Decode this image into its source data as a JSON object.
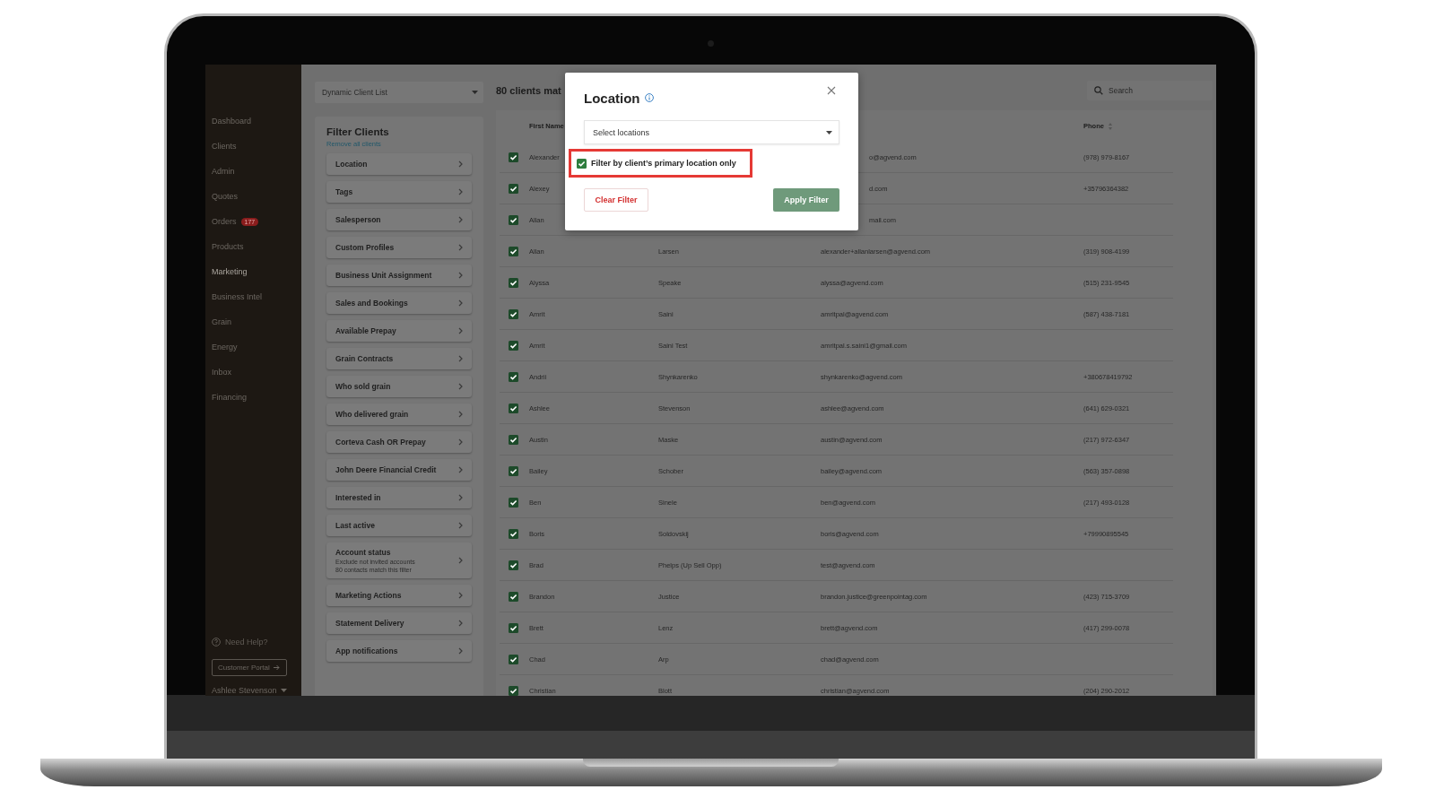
{
  "sidebar": {
    "items": [
      {
        "label": "Dashboard",
        "selected": false
      },
      {
        "label": "Clients",
        "selected": false
      },
      {
        "label": "Admin",
        "selected": false
      },
      {
        "label": "Quotes",
        "selected": false
      },
      {
        "label": "Orders",
        "selected": false,
        "badge": "177"
      },
      {
        "label": "Products",
        "selected": false
      },
      {
        "label": "Marketing",
        "selected": true
      },
      {
        "label": "Business Intel",
        "selected": false
      },
      {
        "label": "Grain",
        "selected": false
      },
      {
        "label": "Energy",
        "selected": false
      },
      {
        "label": "Inbox",
        "selected": false
      },
      {
        "label": "Financing",
        "selected": false
      }
    ],
    "help": "Need Help?",
    "portal_button": "Customer Portal",
    "user": "Ashlee Stevenson"
  },
  "list_dropdown": {
    "value": "Dynamic Client List"
  },
  "filter_panel": {
    "title": "Filter Clients",
    "remove_link": "Remove all clients",
    "filters": [
      {
        "label": "Location"
      },
      {
        "label": "Tags"
      },
      {
        "label": "Salesperson"
      },
      {
        "label": "Custom Profiles"
      },
      {
        "label": "Business Unit Assignment"
      },
      {
        "label": "Sales and Bookings"
      },
      {
        "label": "Available Prepay"
      },
      {
        "label": "Grain Contracts"
      },
      {
        "label": "Who sold grain"
      },
      {
        "label": "Who delivered grain"
      },
      {
        "label": "Corteva Cash OR Prepay"
      },
      {
        "label": "John Deere Financial Credit"
      },
      {
        "label": "Interested in"
      },
      {
        "label": "Last active"
      },
      {
        "label": "Account status",
        "details": [
          "Exclude not invited accounts",
          "80 contacts match this filter"
        ]
      },
      {
        "label": "Marketing Actions"
      },
      {
        "label": "Statement Delivery"
      },
      {
        "label": "App notifications"
      }
    ]
  },
  "results": {
    "heading": "80 clients mat",
    "search": {
      "placeholder": "Search"
    }
  },
  "table": {
    "header": {
      "first_name": "First Name",
      "phone": "Phone"
    },
    "rows": [
      {
        "checked": true,
        "first_name": "Alexander",
        "email": "o@agvend.com",
        "phone": "(978) 979-8167"
      },
      {
        "checked": true,
        "first_name": "Alexey",
        "email": "d.com",
        "phone": "+35796364382"
      },
      {
        "checked": true,
        "first_name": "Allan",
        "email": "mail.com"
      },
      {
        "checked": true,
        "first_name": "Allan",
        "last_name": "Larsen",
        "email": "alexander+allanlarsen@agvend.com",
        "phone": "(319) 908-4199"
      },
      {
        "checked": true,
        "first_name": "Alyssa",
        "last_name": "Speake",
        "email": "alyssa@agvend.com",
        "phone": "(515) 231-9545"
      },
      {
        "checked": true,
        "first_name": "Amrit",
        "last_name": "Saini",
        "email": "amritpal@agvend.com",
        "phone": "(587) 438-7181"
      },
      {
        "checked": true,
        "first_name": "Amrit",
        "last_name": "Saini Test",
        "email": "amritpal.s.saini1@gmail.com"
      },
      {
        "checked": true,
        "first_name": "Andrii",
        "last_name": "Shynkarenko",
        "email": "shynkarenko@agvend.com",
        "phone": "+380678419792"
      },
      {
        "checked": true,
        "first_name": "Ashlee",
        "last_name": "Stevenson",
        "email": "ashlee@agvend.com",
        "phone": "(641) 629-0321"
      },
      {
        "checked": true,
        "first_name": "Austin",
        "last_name": "Maske",
        "email": "austin@agvend.com",
        "phone": "(217) 972-6347"
      },
      {
        "checked": true,
        "first_name": "Bailey",
        "last_name": "Schober",
        "email": "bailey@agvend.com",
        "phone": "(563) 357-0898"
      },
      {
        "checked": true,
        "first_name": "Ben",
        "last_name": "Sinele",
        "email": "ben@agvend.com",
        "phone": "(217) 493-0128"
      },
      {
        "checked": true,
        "first_name": "Boris",
        "last_name": "Soldovskij",
        "email": "boris@agvend.com",
        "phone": "+79990895545"
      },
      {
        "checked": true,
        "first_name": "Brad",
        "last_name": "Phelps (Up Sell Opp)",
        "email": "test@agvend.com"
      },
      {
        "checked": true,
        "first_name": "Brandon",
        "last_name": "Justice",
        "email": "brandon.justice@greenpointag.com",
        "phone": "(423) 715-3709"
      },
      {
        "checked": true,
        "first_name": "Brett",
        "last_name": "Lenz",
        "email": "brett@agvend.com",
        "phone": "(417) 299-0078"
      },
      {
        "checked": true,
        "first_name": "Chad",
        "last_name": "Arp",
        "email": "chad@agvend.com"
      },
      {
        "checked": true,
        "first_name": "Christian",
        "last_name": "Blott",
        "email": "christian@agvend.com",
        "phone": "(204) 290-2012"
      }
    ]
  },
  "modal": {
    "title": "Location",
    "select": {
      "placeholder": "Select locations"
    },
    "primary_only": {
      "label": "Filter by client’s primary location only",
      "checked": true,
      "highlighted": true
    },
    "clear_button": "Clear Filter",
    "apply_button": {
      "label": "Apply Filter",
      "disabled": true
    }
  }
}
